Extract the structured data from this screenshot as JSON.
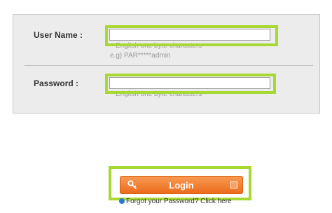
{
  "form": {
    "username": {
      "label": "User Name :",
      "value": "",
      "hint_line1": "English one byte characters",
      "hint_line2": "e.g) PAR*****admin"
    },
    "password": {
      "label": "Password :",
      "value": "",
      "hint": "English one byte characters"
    }
  },
  "login_button": {
    "label": "Login",
    "icon": "key-icon",
    "arrow_icon": "arrow-right-icon"
  },
  "forgot_link": {
    "text": "Forgot your Password? Click here",
    "icon": "help-icon"
  },
  "colors": {
    "highlight": "#a8d832",
    "button_orange": "#ec6b1c",
    "panel_bg": "#ececec"
  }
}
